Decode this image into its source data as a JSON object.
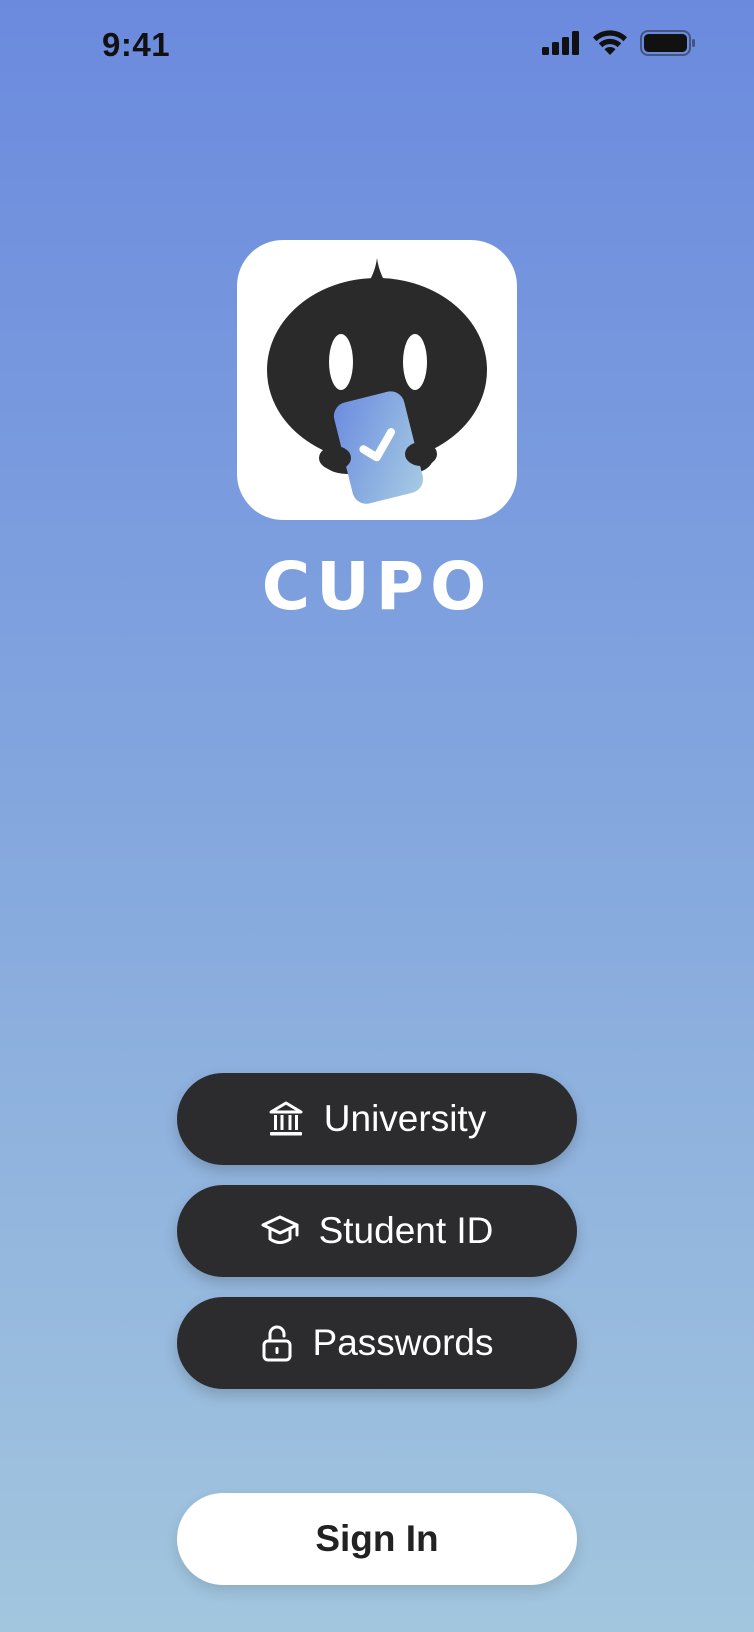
{
  "status_bar": {
    "time": "9:41",
    "icons": [
      "cellular-signal-icon",
      "wifi-icon",
      "battery-icon"
    ]
  },
  "app": {
    "name": "CUPO",
    "logo": "cupo-mascot-logo"
  },
  "form": {
    "university_label": "University",
    "university_icon": "institution-icon",
    "student_id_label": "Student ID",
    "student_id_icon": "graduation-cap-icon",
    "password_label": "Passwords",
    "password_icon": "unlock-icon"
  },
  "actions": {
    "sign_in_label": "Sign In"
  },
  "colors": {
    "gradient_top": "#6b8ade",
    "gradient_bottom": "#a2c6de",
    "pill_background": "#2c2c2e",
    "sign_in_background": "#ffffff"
  }
}
